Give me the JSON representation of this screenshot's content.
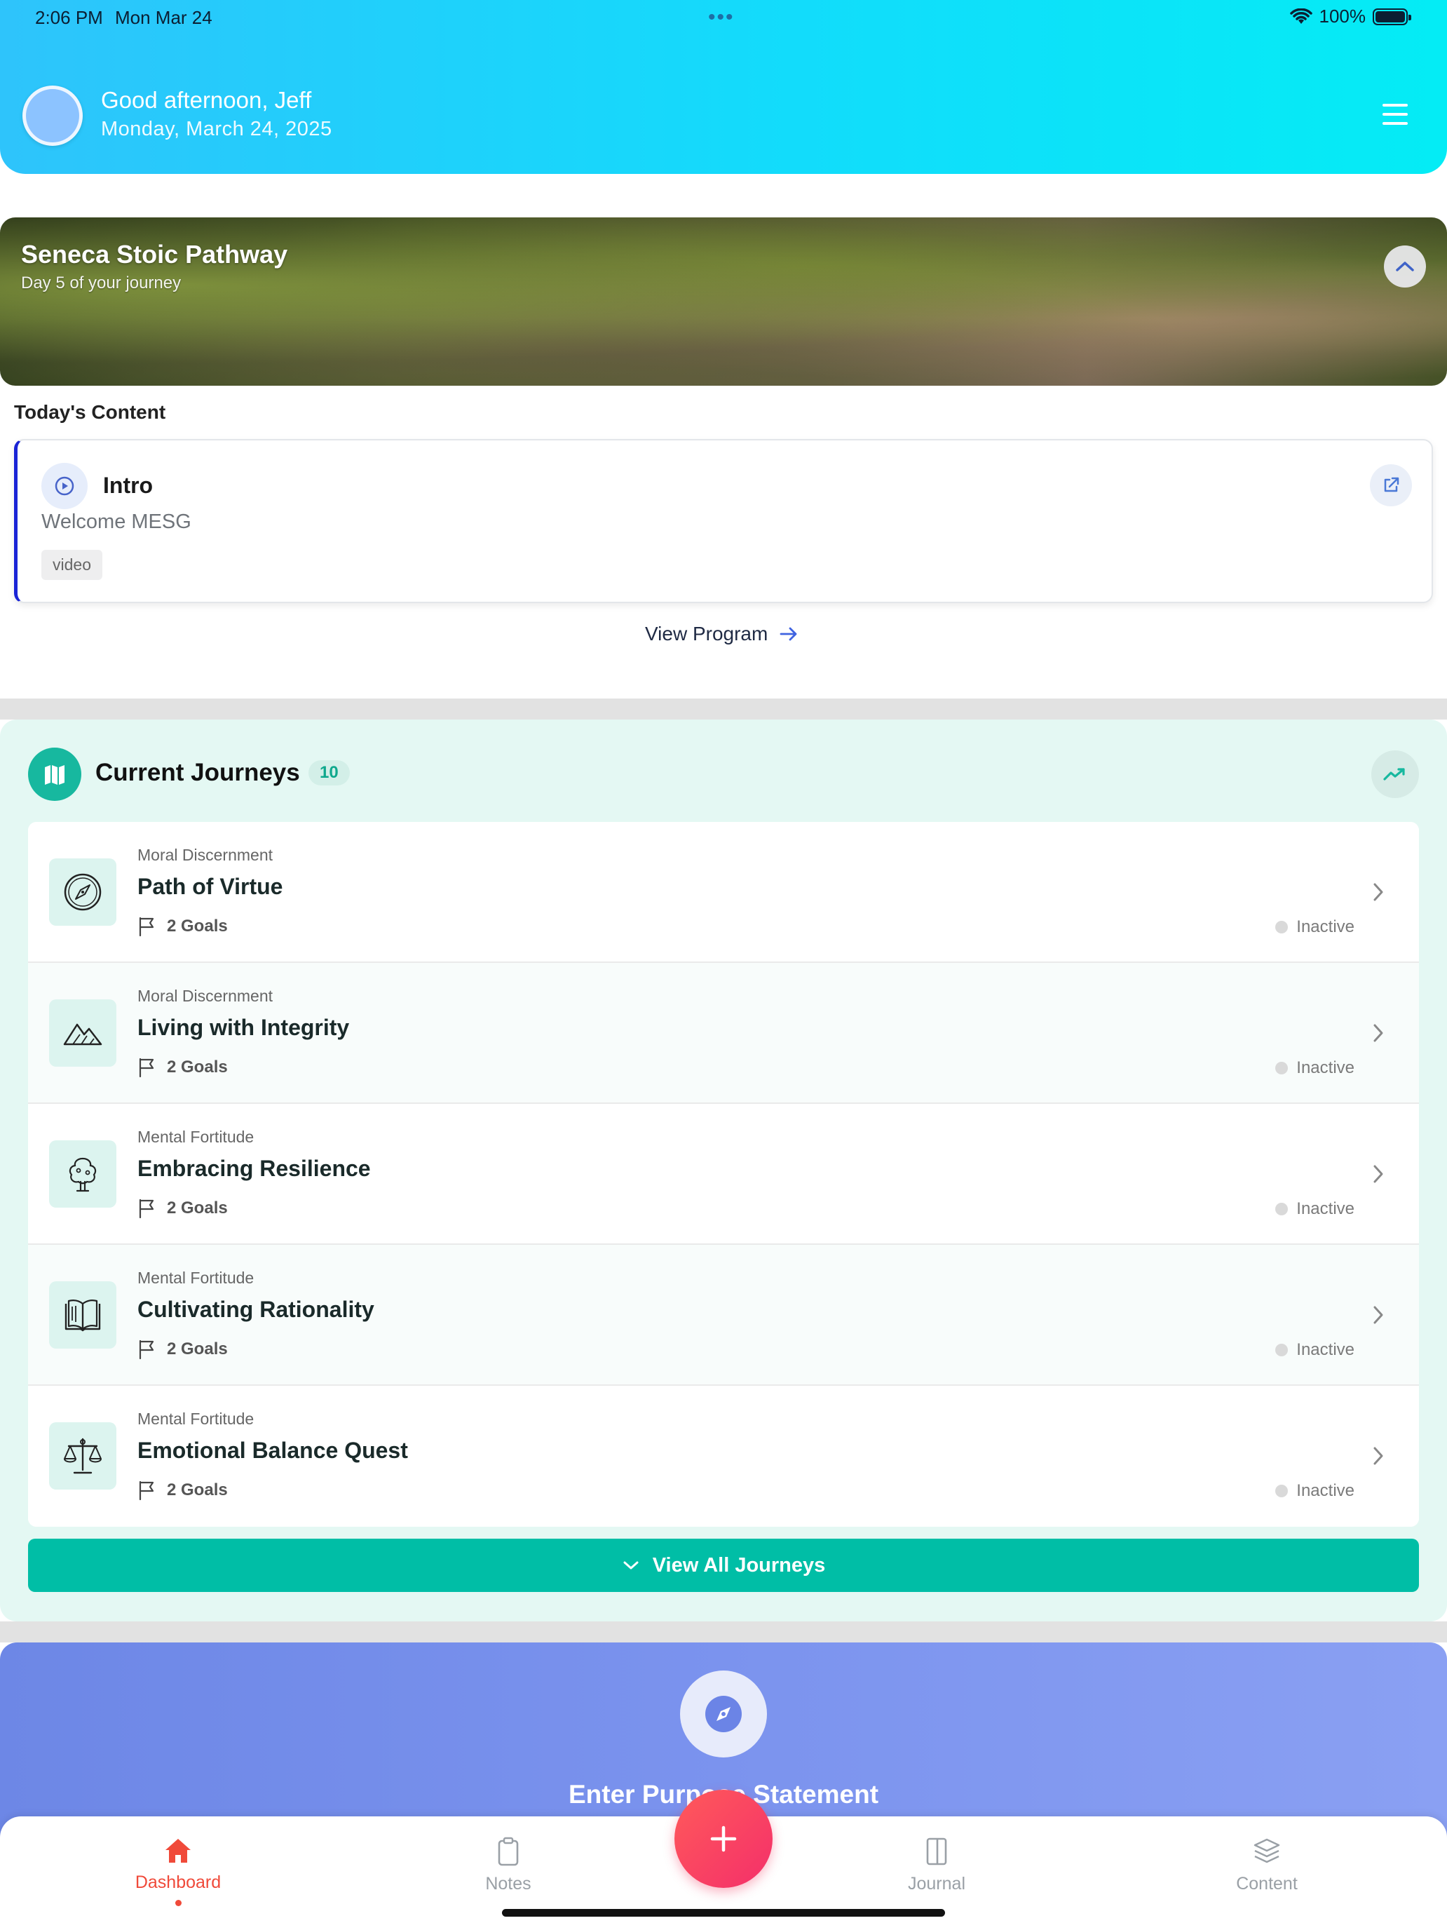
{
  "status_bar": {
    "time": "2:06 PM",
    "date": "Mon Mar 24",
    "dots": "•••",
    "battery": "100%"
  },
  "header": {
    "greeting": "Good afternoon, Jeff",
    "date": "Monday, March 24, 2025"
  },
  "pathway": {
    "title": "Seneca Stoic Pathway",
    "subtitle": "Day 5 of your journey"
  },
  "todays_content": {
    "label": "Today's Content",
    "item": {
      "title": "Intro",
      "subtitle": "Welcome MESG",
      "tag": "video"
    },
    "view_program": "View Program"
  },
  "journeys": {
    "title": "Current Journeys",
    "count": "10",
    "items": [
      {
        "category": "Moral Discernment",
        "name": "Path of Virtue",
        "goals": "2 Goals",
        "status": "Inactive",
        "icon": "compass-icon"
      },
      {
        "category": "Moral Discernment",
        "name": "Living with Integrity",
        "goals": "2 Goals",
        "status": "Inactive",
        "icon": "mountain-icon"
      },
      {
        "category": "Mental Fortitude",
        "name": "Embracing Resilience",
        "goals": "2 Goals",
        "status": "Inactive",
        "icon": "tree-icon"
      },
      {
        "category": "Mental Fortitude",
        "name": "Cultivating Rationality",
        "goals": "2 Goals",
        "status": "Inactive",
        "icon": "book-icon"
      },
      {
        "category": "Mental Fortitude",
        "name": "Emotional Balance Quest",
        "goals": "2 Goals",
        "status": "Inactive",
        "icon": "scale-icon"
      }
    ],
    "view_all": "View All Journeys"
  },
  "purpose": {
    "label": "Enter Purpose Statement"
  },
  "tabbar": {
    "dashboard": "Dashboard",
    "notes": "Notes",
    "journal": "Journal",
    "content": "Content"
  },
  "colors": {
    "accent": "#00bea6",
    "active_tab": "#f04a3a",
    "header_start": "#2ec4fb",
    "header_end": "#04ecf5"
  }
}
